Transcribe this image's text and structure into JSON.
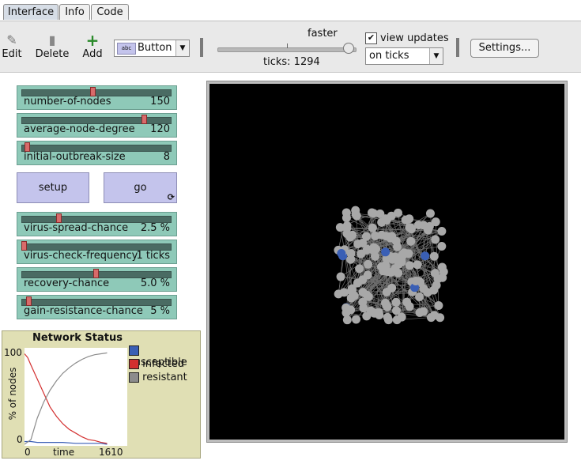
{
  "tabs": [
    {
      "label": "Interface",
      "active": true
    },
    {
      "label": "Info",
      "active": false
    },
    {
      "label": "Code",
      "active": false
    }
  ],
  "toolbar": {
    "edit_label": "Edit",
    "delete_label": "Delete",
    "add_label": "Add",
    "widget_type": "Button",
    "widget_icon_text": "abc",
    "speed_label": "faster",
    "speed_fraction": 0.98,
    "ticks_text": "ticks: 1294",
    "view_updates_label": "view updates",
    "view_updates_checked": true,
    "update_mode": "on ticks",
    "settings_label": "Settings..."
  },
  "sliders": [
    {
      "label": "number-of-nodes",
      "value": "150",
      "fraction": 0.47
    },
    {
      "label": "average-node-degree",
      "value": "120",
      "fraction": 0.82
    },
    {
      "label": "initial-outbreak-size",
      "value": "8",
      "fraction": 0.02
    },
    {
      "label": "virus-spread-chance",
      "value": "2.5 %",
      "fraction": 0.24
    },
    {
      "label": "virus-check-frequency",
      "value": "1 ticks",
      "fraction": 0.0
    },
    {
      "label": "recovery-chance",
      "value": "5.0 %",
      "fraction": 0.49
    },
    {
      "label": "gain-resistance-chance",
      "value": "5 %",
      "fraction": 0.03
    }
  ],
  "buttons": {
    "setup_label": "setup",
    "go_label": "go"
  },
  "plot": {
    "title": "Network Status",
    "ylabel": "% of nodes",
    "xlabel": "time",
    "x_min_label": "0",
    "x_max_label": "1610",
    "y_max_label": "100",
    "y_min_label": "0",
    "legend": [
      {
        "name": "susceptible",
        "color": "#3a5fb5"
      },
      {
        "name": "infected",
        "color": "#d32f2f"
      },
      {
        "name": "resistant",
        "color": "#8c8c8c"
      }
    ]
  },
  "chart_data": {
    "type": "line",
    "title": "Network Status",
    "xlabel": "time",
    "ylabel": "% of nodes",
    "xlim": [
      0,
      1610
    ],
    "ylim": [
      0,
      100
    ],
    "legend_position": "right",
    "series": [
      {
        "name": "susceptible",
        "color": "#3a5fb5",
        "x": [
          0,
          100,
          200,
          400,
          600,
          800,
          1000,
          1200,
          1294
        ],
        "y": [
          3,
          3,
          2,
          2,
          2,
          1,
          1,
          1,
          0
        ]
      },
      {
        "name": "infected",
        "color": "#d32f2f",
        "x": [
          0,
          50,
          100,
          200,
          300,
          400,
          500,
          600,
          700,
          800,
          900,
          1000,
          1100,
          1200,
          1294
        ],
        "y": [
          97,
          93,
          85,
          70,
          55,
          40,
          30,
          22,
          16,
          12,
          8,
          5,
          4,
          2,
          1
        ]
      },
      {
        "name": "resistant",
        "color": "#8c8c8c",
        "x": [
          0,
          100,
          200,
          300,
          400,
          500,
          600,
          700,
          800,
          900,
          1000,
          1100,
          1200,
          1294
        ],
        "y": [
          0,
          5,
          28,
          45,
          58,
          68,
          76,
          82,
          87,
          91,
          94,
          96,
          97,
          98
        ]
      }
    ]
  },
  "view": {
    "background": "#000000",
    "node_color_resistant": "#a8a8a8",
    "node_color_susceptible": "#3a5fb5"
  }
}
